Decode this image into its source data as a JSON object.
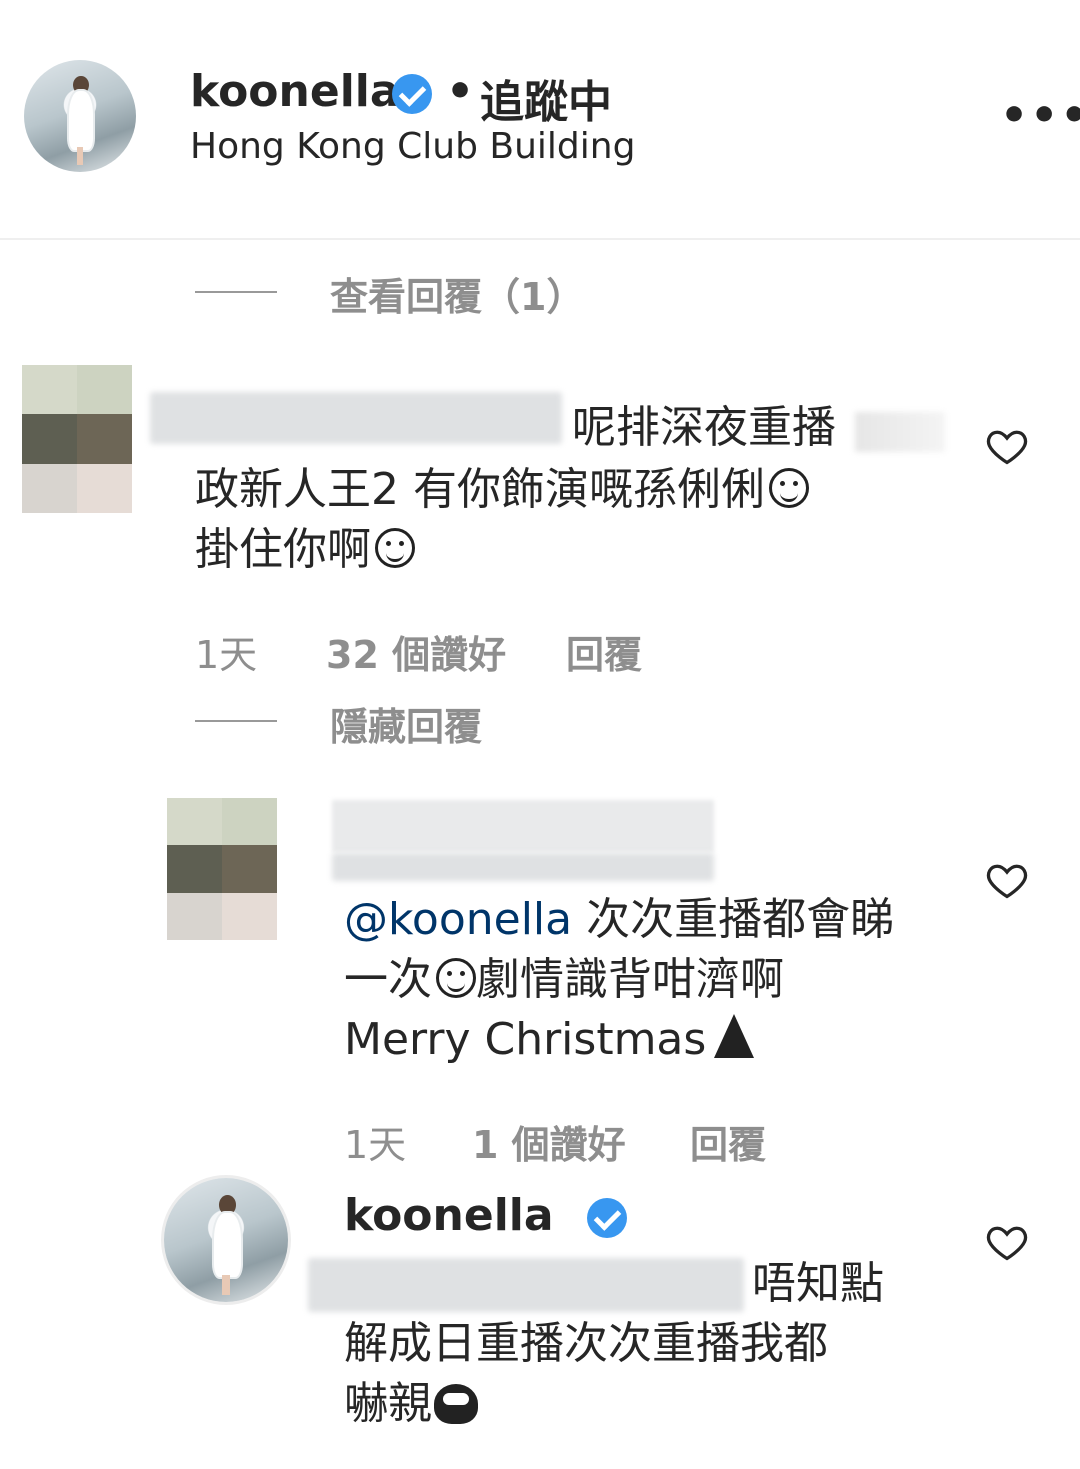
{
  "header": {
    "username": "koonella",
    "separator": "•",
    "follow_status": "追蹤中",
    "location": "Hong Kong Club Building",
    "more_label": "•••"
  },
  "comments": [
    {
      "view_replies": "查看回覆（1）",
      "text_line1": "呢排深夜重播",
      "text_line2": "政新人王2 有你飾演嘅孫俐俐",
      "text_line3": "掛住你啊",
      "time": "1天",
      "likes": "32 個讚好",
      "reply": "回覆",
      "hide_replies": "隱藏回覆"
    },
    {
      "mention": "@koonella",
      "text_line1": "次次重播都會睇",
      "text_line2a": "一次",
      "text_line2b": "劇情識背咁濟啊",
      "text_line3": "Merry Christmas",
      "time": "1天",
      "likes": "1 個讚好",
      "reply": "回覆"
    },
    {
      "username": "koonella",
      "text_line1": "唔知點",
      "text_line2": "解成日重播次次重播我都",
      "text_line3": "嚇親"
    }
  ],
  "colors": {
    "verified_blue": "#3897f0",
    "text": "#262626",
    "secondary": "#8e8e8e",
    "mention": "#003569"
  },
  "icons": [
    "more-options-icon",
    "verified-badge-icon",
    "heart-icon"
  ]
}
